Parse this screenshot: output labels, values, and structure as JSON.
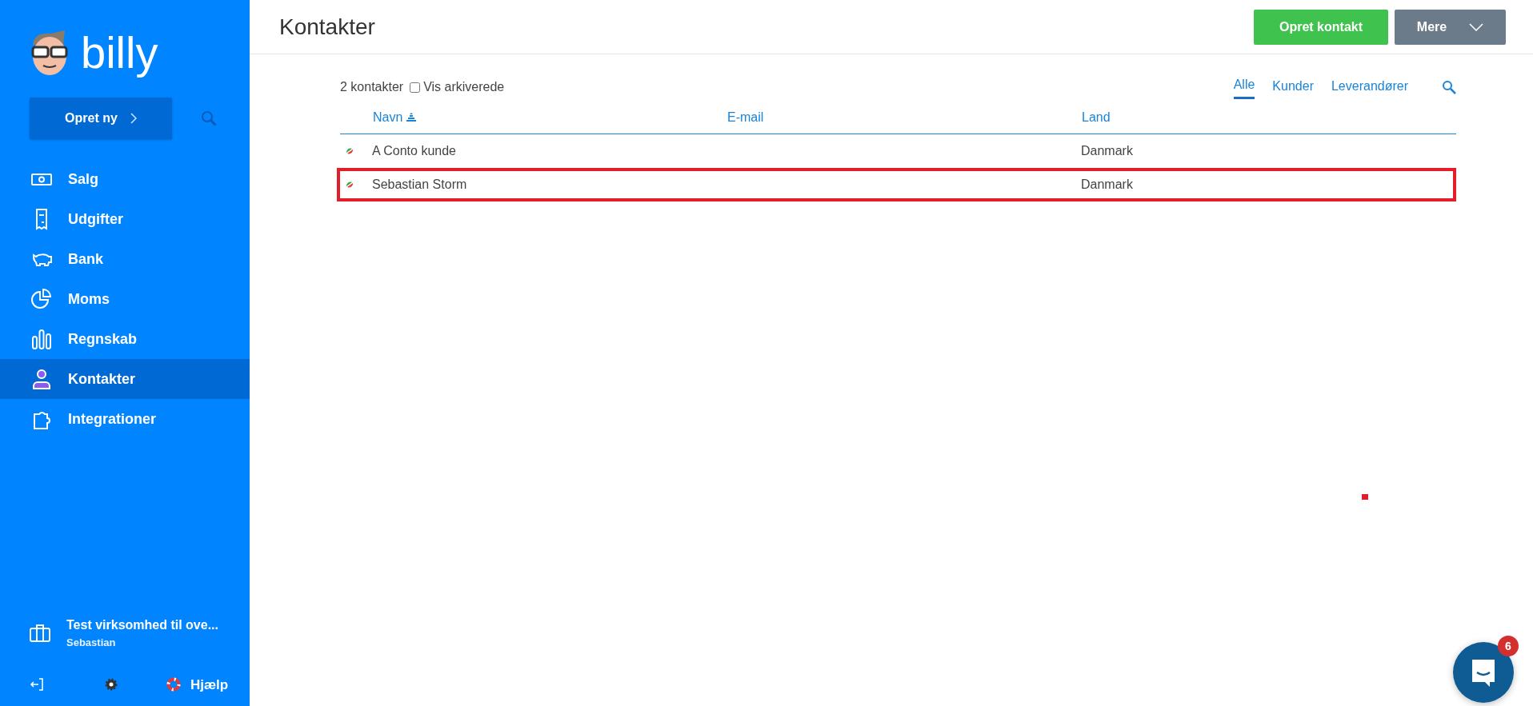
{
  "sidebar": {
    "logo": "billy",
    "create_button": "Opret ny",
    "nav_items": [
      {
        "label": "Salg",
        "selected": false
      },
      {
        "label": "Udgifter",
        "selected": false
      },
      {
        "label": "Bank",
        "selected": false
      },
      {
        "label": "Moms",
        "selected": false
      },
      {
        "label": "Regnskab",
        "selected": false
      },
      {
        "label": "Kontakter",
        "selected": true
      },
      {
        "label": "Integrationer",
        "selected": false
      }
    ],
    "company": {
      "name": "Test virksomhed til ove...",
      "user": "Sebastian"
    },
    "help_link": "Hjælp"
  },
  "header": {
    "title": "Kontakter",
    "primary_button": "Opret kontakt",
    "more_button": "Mere"
  },
  "toolbar": {
    "count": "2 kontakter",
    "archived_checkbox": {
      "label": "Vis arkiverede",
      "checked": false
    },
    "filter_tabs": [
      {
        "label": "Alle",
        "selected": true
      },
      {
        "label": "Kunder",
        "selected": false
      },
      {
        "label": "Leverandører",
        "selected": false
      }
    ]
  },
  "table": {
    "columns": [
      "Navn",
      "E-mail",
      "Land"
    ],
    "rows": [
      {
        "name": "A Conto kunde",
        "country": "Danmark",
        "highlighted": false
      },
      {
        "name": "Sebastian Storm",
        "country": "Danmark",
        "highlighted": true
      }
    ]
  },
  "chat": {
    "badge": "6"
  }
}
